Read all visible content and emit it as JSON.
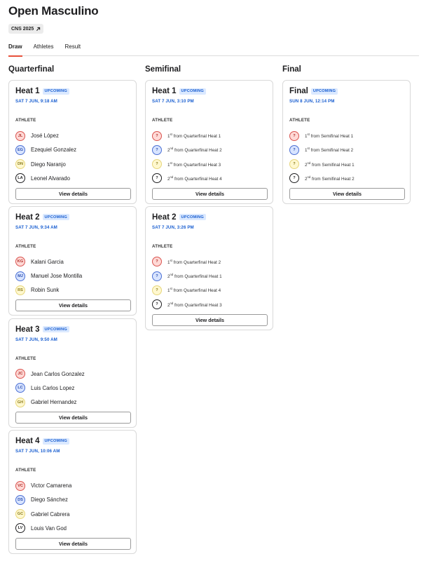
{
  "page": {
    "title": "Open Masculino",
    "event_tag": "CNS 2025"
  },
  "tabs": [
    "Draw",
    "Athletes",
    "Result"
  ],
  "colors": {
    "accent": "#e8503a",
    "badge_text": "#1a5fd1",
    "badge_bg": "#dbe9ff"
  },
  "columns": [
    {
      "title": "Quarterfinal",
      "cards": [
        {
          "title": "Heat 1",
          "status": "UPCOMING",
          "time": "SAT 7 JUN, 9:18 AM",
          "athlete_label": "ATHLETE",
          "button": "View details",
          "athletes": [
            {
              "initials": "JL",
              "name": "José López",
              "color": "red"
            },
            {
              "initials": "EG",
              "name": "Ezequiel Gonzalez",
              "color": "blue"
            },
            {
              "initials": "DN",
              "name": "Diego Naranjo",
              "color": "yellow"
            },
            {
              "initials": "LA",
              "name": "Leonel Alvarado",
              "color": "plain"
            }
          ]
        },
        {
          "title": "Heat 2",
          "status": "UPCOMING",
          "time": "SAT 7 JUN, 9:34 AM",
          "athlete_label": "ATHLETE",
          "button": "View details",
          "athletes": [
            {
              "initials": "KG",
              "name": "Kalani Garcia",
              "color": "red"
            },
            {
              "initials": "MJ",
              "name": "Manuel Jose Montilla",
              "color": "blue"
            },
            {
              "initials": "RS",
              "name": "Robin Sunk",
              "color": "yellow"
            }
          ]
        },
        {
          "title": "Heat 3",
          "status": "UPCOMING",
          "time": "SAT 7 JUN, 9:50 AM",
          "athlete_label": "ATHLETE",
          "button": "View details",
          "athletes": [
            {
              "initials": "JC",
              "name": "Jean Carlos Gonzalez",
              "color": "red"
            },
            {
              "initials": "LC",
              "name": "Luis Carlos Lopez",
              "color": "blue"
            },
            {
              "initials": "GH",
              "name": "Gabriel Hernandez",
              "color": "yellow"
            }
          ]
        },
        {
          "title": "Heat 4",
          "status": "UPCOMING",
          "time": "SAT 7 JUN, 10:06 AM",
          "athlete_label": "ATHLETE",
          "button": "View details",
          "athletes": [
            {
              "initials": "VC",
              "name": "Victor Camarena",
              "color": "red"
            },
            {
              "initials": "DS",
              "name": "Diego Sánchez",
              "color": "blue"
            },
            {
              "initials": "GC",
              "name": "Gabriel Cabrera",
              "color": "yellow"
            },
            {
              "initials": "LV",
              "name": "Louis Van God",
              "color": "plain"
            }
          ]
        }
      ]
    },
    {
      "title": "Semifinal",
      "cards": [
        {
          "title": "Heat 1",
          "status": "UPCOMING",
          "time": "SAT 7 JUN, 3:10 PM",
          "athlete_label": "ATHLETE",
          "button": "View details",
          "athletes": [
            {
              "initials": "?",
              "place": "1",
              "suffix": "st",
              "source": "from Quarterfinal Heat 1",
              "color": "red"
            },
            {
              "initials": "?",
              "place": "2",
              "suffix": "nd",
              "source": "from Quarterfinal Heat 2",
              "color": "blue"
            },
            {
              "initials": "?",
              "place": "1",
              "suffix": "st",
              "source": "from Quarterfinal Heat 3",
              "color": "yellow"
            },
            {
              "initials": "?",
              "place": "2",
              "suffix": "nd",
              "source": "from Quarterfinal Heat 4",
              "color": "plain"
            }
          ]
        },
        {
          "title": "Heat 2",
          "status": "UPCOMING",
          "time": "SAT 7 JUN, 3:26 PM",
          "athlete_label": "ATHLETE",
          "button": "View details",
          "athletes": [
            {
              "initials": "?",
              "place": "1",
              "suffix": "st",
              "source": "from Quarterfinal Heat 2",
              "color": "red"
            },
            {
              "initials": "?",
              "place": "2",
              "suffix": "nd",
              "source": "from Quarterfinal Heat 1",
              "color": "blue"
            },
            {
              "initials": "?",
              "place": "1",
              "suffix": "st",
              "source": "from Quarterfinal Heat 4",
              "color": "yellow"
            },
            {
              "initials": "?",
              "place": "2",
              "suffix": "nd",
              "source": "from Quarterfinal Heat 3",
              "color": "plain"
            }
          ]
        }
      ]
    },
    {
      "title": "Final",
      "cards": [
        {
          "title": "Final",
          "status": "UPCOMING",
          "time": "SUN 8 JUN, 12:14 PM",
          "athlete_label": "ATHLETE",
          "button": "View details",
          "athletes": [
            {
              "initials": "?",
              "place": "1",
              "suffix": "st",
              "source": "from Semifinal Heat 1",
              "color": "red"
            },
            {
              "initials": "?",
              "place": "1",
              "suffix": "st",
              "source": "from Semifinal Heat 2",
              "color": "blue"
            },
            {
              "initials": "?",
              "place": "2",
              "suffix": "nd",
              "source": "from Semifinal Heat 1",
              "color": "yellow"
            },
            {
              "initials": "?",
              "place": "2",
              "suffix": "nd",
              "source": "from Semifinal Heat 2",
              "color": "plain"
            }
          ]
        }
      ]
    }
  ]
}
